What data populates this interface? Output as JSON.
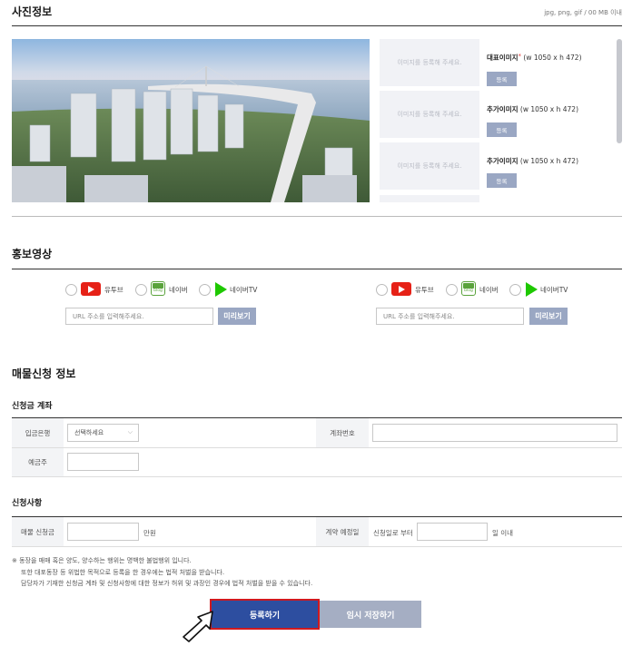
{
  "photo_section": {
    "title": "사진정보",
    "format_note": "jpg, png, gif / 00 MB 이내",
    "upload_placeholder": "이미지를 등록해 주세요.",
    "slots": [
      {
        "label": "대표이미지",
        "required_mark": "*",
        "size": "(w 1050 x h 472)",
        "button": "등록"
      },
      {
        "label": "추가이미지",
        "required_mark": "",
        "size": "(w 1050 x h 472)",
        "button": "등록"
      },
      {
        "label": "추가이미지",
        "required_mark": "",
        "size": "(w 1050 x h 472)",
        "button": "등록"
      }
    ]
  },
  "video_section": {
    "title": "홍보영상",
    "groups": [
      {
        "options": [
          "유투브",
          "네이버",
          "네이버TV"
        ],
        "url_placeholder": "URL 주소를 입력해주세요.",
        "preview_button": "미리보기"
      },
      {
        "options": [
          "유투브",
          "네이버",
          "네이버TV"
        ],
        "url_placeholder": "URL 주소를 입력해주세요.",
        "preview_button": "미리보기"
      }
    ],
    "blog_icon_text": "blog"
  },
  "sale_section": {
    "title": "매물신청 정보",
    "account": {
      "title": "신청금 계좌",
      "bank_label": "입금은행",
      "bank_select": "선택하세요",
      "account_label": "계좌번호",
      "holder_label": "예금주"
    },
    "request": {
      "title": "신청사항",
      "amount_label": "매물 신청금",
      "amount_unit": "만원",
      "period_label": "계약 예정일",
      "period_prefix": "신청일로 부터",
      "period_suffix": "일 이내"
    }
  },
  "notes": [
    "※ 동장을 매매 혹은 양도, 양수하는 행위는 명백한 불법행위 입니다.",
    "또한 대포동장 등 위법한 목적으로 등록을 한 경우에는 법적 처벌을 받습니다.",
    "담당자가 기재한 신청금 계좌 및 신청사항에 대한 정보가 허위 및 과장인 경우에 법적 처벌을 받을 수 있습니다."
  ],
  "buttons": {
    "submit": "등록하기",
    "temp_save": "임시 저장하기"
  },
  "colors": {
    "primary": "#2d4ea0",
    "secondary": "#a5aec3",
    "sub_button": "#9aa7c3",
    "highlight_outline": "#d0191f"
  }
}
